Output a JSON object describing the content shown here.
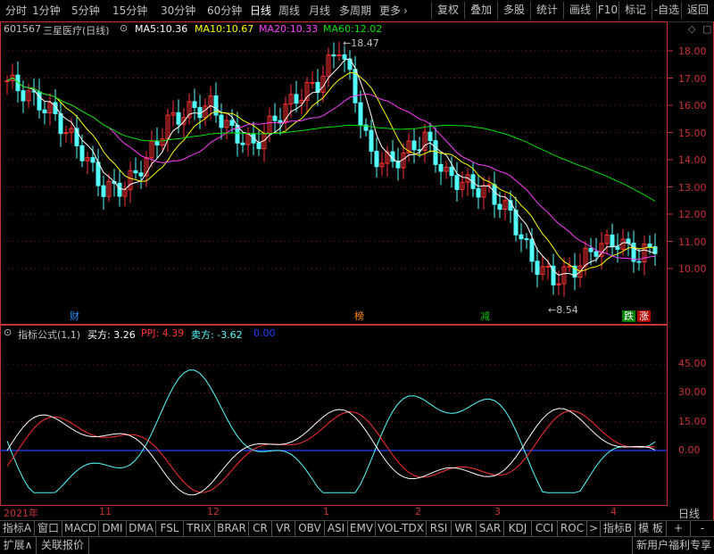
{
  "toolbar": {
    "periods": [
      "分时",
      "1分钟",
      "5分钟",
      "15分钟",
      "30分钟",
      "60分钟",
      "日线",
      "周线",
      "月线",
      "多周期",
      "更多"
    ],
    "active_period": "日线",
    "more_arrow": "›",
    "right_buttons": [
      "复权",
      "叠加",
      "多股",
      "统计",
      "画线",
      "F10",
      "标记",
      "-自选",
      "返回"
    ]
  },
  "main_chart": {
    "stock_code": "601567",
    "stock_name": "三星医疗(日线)",
    "ma": [
      {
        "label": "MA5:",
        "value": "10.36",
        "color": "#ffffff"
      },
      {
        "label": "MA10:",
        "value": "10.67",
        "color": "#ffff00"
      },
      {
        "label": "MA20:",
        "value": "10.33",
        "color": "#ff40ff"
      },
      {
        "label": "MA60:",
        "value": "12.02",
        "color": "#00e000"
      }
    ],
    "y_ticks": [
      "18.00",
      "17.00",
      "16.00",
      "15.00",
      "14.00",
      "13.00",
      "12.00",
      "11.00",
      "10.00"
    ],
    "high_label": "18.47",
    "low_label": "8.54",
    "event_marks": [
      {
        "text": "财",
        "color": "#1e90ff",
        "bg": ""
      },
      {
        "text": "榜",
        "color": "#ff8c00",
        "bg": ""
      },
      {
        "text": "减",
        "color": "#00c000",
        "bg": ""
      },
      {
        "text": "跌",
        "color": "#ffffff",
        "bg": "#008000"
      },
      {
        "text": "涨",
        "color": "#ffffff",
        "bg": "#b00000"
      }
    ]
  },
  "indicator": {
    "title": "指标公式(1,1)",
    "buy_label": "买方:",
    "buy_value": "3.26",
    "ppj_label": "PPJ:",
    "ppj_value": "4.39",
    "sell_label": "卖方:",
    "sell_value": "-3.62",
    "extra_value": "0.00",
    "y_ticks": [
      "45.00",
      "30.00",
      "15.00",
      "0.00"
    ]
  },
  "time_axis": {
    "labels": [
      "2021年",
      "11",
      "12",
      "1",
      "2",
      "3",
      "4"
    ],
    "right_label": "日线"
  },
  "bottom_tabs": {
    "items": [
      "指标A",
      "窗口",
      "MACD",
      "DMI",
      "DMA",
      "FSL",
      "TRIX",
      "BRAR",
      "CR",
      "VR",
      "OBV",
      "ASI",
      "EMV",
      "VOL-TDX",
      "RSI",
      "WR",
      "SAR",
      "KDJ",
      "CCI",
      "ROC"
    ],
    "more_arrow": ">",
    "tail": [
      "指标B",
      "模 板",
      "+",
      "-"
    ]
  },
  "status_bar": {
    "expand": "扩展∧",
    "related": "关联报价",
    "promo": "新用户福利专享"
  },
  "colors": {
    "up_candle": "#ff3232",
    "down_candle": "#54ffff",
    "ma5": "#ffffff",
    "ma10": "#ffff00",
    "ma20": "#ff40ff",
    "ma60": "#00e000",
    "grid": "#c83232"
  }
}
